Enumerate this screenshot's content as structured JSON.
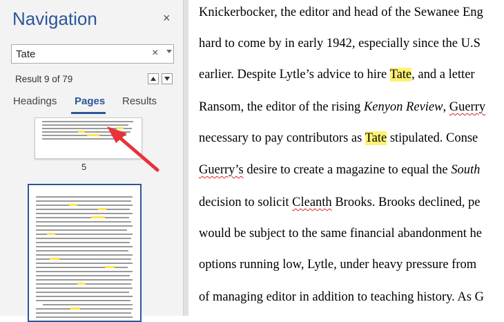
{
  "nav": {
    "title": "Navigation",
    "close_label": "×",
    "search_value": "Tate",
    "clear_label": "×",
    "result_count": "Result 9 of 79",
    "tabs": {
      "headings": "Headings",
      "pages": "Pages",
      "results": "Results"
    },
    "page5_label": "5"
  },
  "document": {
    "line1": {
      "a": "Knickerbocker, the editor and head of the Sewanee Eng"
    },
    "line2": {
      "a": "hard to come by in early 1942, especially since the U.S"
    },
    "line3": {
      "a": "earlier.  Despite Lytle’s advice to hire ",
      "hl": "Tate",
      "b": ", and a letter"
    },
    "line4": {
      "a": "Ransom, the editor of the rising ",
      "i": "Kenyon Review",
      "b": ", ",
      "sq": "Guerry"
    },
    "line5": {
      "a": "necessary to pay contributors as ",
      "hl": "Tate",
      "b": " stipulated. Conse"
    },
    "line6": {
      "sq": "Guerry’s",
      "a": " desire to create a magazine to equal the ",
      "i": "South"
    },
    "line7": {
      "a": "decision to solicit ",
      "sq": "Cleanth",
      "b": " Brooks. Brooks declined, pe"
    },
    "line8": {
      "a": "would be subject to the same financial abandonment he"
    },
    "line9": {
      "a": "options running low, Lytle, under heavy pressure from"
    },
    "line10": {
      "a": "of managing editor in addition to teaching history. As G"
    }
  },
  "colors": {
    "accent": "#2b579a",
    "highlight": "#fff173",
    "arrow": "#e8323c"
  },
  "icons": {
    "close": "close-icon",
    "clear": "clear-search-icon",
    "dropdown": "dropdown-icon",
    "prev": "up-arrow-icon",
    "next": "down-arrow-icon"
  }
}
